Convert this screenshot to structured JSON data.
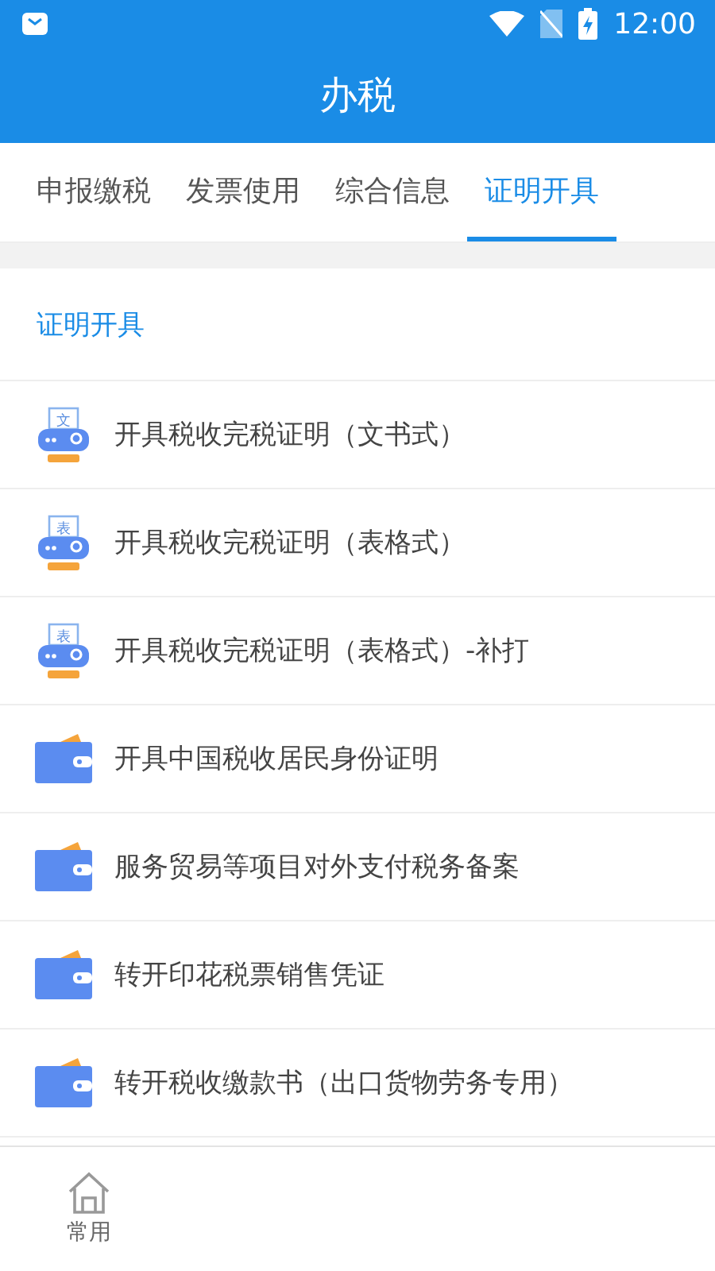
{
  "status_bar": {
    "time": "12:00"
  },
  "header": {
    "title": "办税"
  },
  "tabs": [
    {
      "label": "申报缴税",
      "selected": false
    },
    {
      "label": "发票使用",
      "selected": false
    },
    {
      "label": "综合信息",
      "selected": false
    },
    {
      "label": "证明开具",
      "selected": true
    }
  ],
  "section": {
    "title": "证明开具"
  },
  "items": [
    {
      "kind": "printer",
      "icon_char": "文",
      "label": "开具税收完税证明（文书式）"
    },
    {
      "kind": "printer",
      "icon_char": "表",
      "label": "开具税收完税证明（表格式）"
    },
    {
      "kind": "printer",
      "icon_char": "表",
      "label": "开具税收完税证明（表格式）-补打"
    },
    {
      "kind": "wallet",
      "label": "开具中国税收居民身份证明"
    },
    {
      "kind": "wallet",
      "label": "服务贸易等项目对外支付税务备案"
    },
    {
      "kind": "wallet",
      "label": "转开印花税票销售凭证"
    },
    {
      "kind": "wallet",
      "label": "转开税收缴款书（出口货物劳务专用）"
    }
  ],
  "bottom_nav": [
    {
      "label": "常用"
    }
  ]
}
